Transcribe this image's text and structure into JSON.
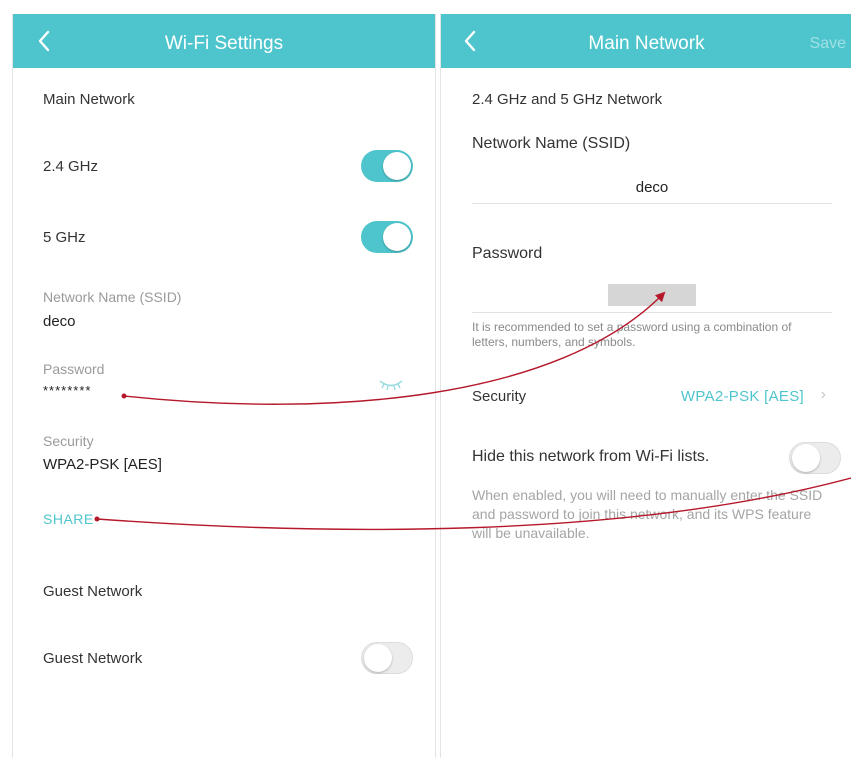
{
  "left": {
    "header": {
      "title": "Wi-Fi Settings"
    },
    "main_network_section": "Main Network",
    "band_24": {
      "label": "2.4 GHz",
      "enabled": true
    },
    "band_5": {
      "label": "5 GHz",
      "enabled": true
    },
    "ssid": {
      "label": "Network Name (SSID)",
      "value": "deco"
    },
    "password": {
      "label": "Password",
      "value": "********",
      "reveal_icon": "eye-closed-icon"
    },
    "security": {
      "label": "Security",
      "value": "WPA2-PSK [AES]"
    },
    "share_label": "SHARE",
    "guest_section": "Guest Network",
    "guest_network": {
      "label": "Guest Network",
      "enabled": false
    }
  },
  "right": {
    "header": {
      "title": "Main Network",
      "save_label": "Save"
    },
    "band_section": "2.4 GHz and 5 GHz Network",
    "ssid": {
      "label": "Network Name (SSID)",
      "value": "deco"
    },
    "password": {
      "label": "Password"
    },
    "password_hint": "It is recommended to set a password using a combination of letters, numbers, and symbols.",
    "security": {
      "label": "Security",
      "value": "WPA2-PSK [AES]"
    },
    "hide": {
      "label": "Hide this network from Wi-Fi lists.",
      "enabled": false
    },
    "hide_note": "When enabled, you will need to manually enter the SSID and password to join this network, and its WPS feature will be unavailable."
  },
  "colors": {
    "accent": "#4ec5cc",
    "annotation_arrow": "#b5182b"
  }
}
